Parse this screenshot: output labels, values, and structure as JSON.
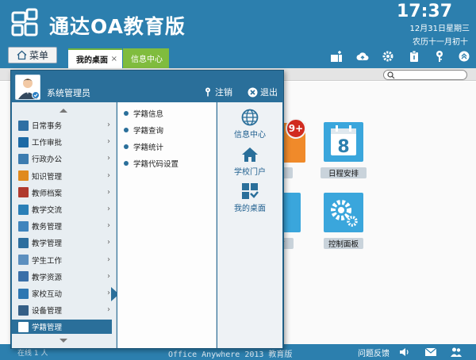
{
  "header": {
    "app_title": "通达OA教育版",
    "time": "17:37",
    "date": "12月31日星期三",
    "lunar_date": "农历十一月初十",
    "menu_label": "菜单"
  },
  "tabs": [
    {
      "label": "我的桌面",
      "close": "×"
    },
    {
      "label": "信息中心"
    }
  ],
  "desktop": {
    "badge": "9+",
    "tiles": [
      {
        "label": "乍"
      },
      {
        "label": "日程安排",
        "icon_number": "8"
      },
      {
        "label": "言"
      },
      {
        "label": "控制面板"
      }
    ]
  },
  "start_menu": {
    "user_name": "系统管理员",
    "logout_label": "注销",
    "exit_label": "退出",
    "items": [
      {
        "label": "日常事务",
        "color": "#2f6fa3"
      },
      {
        "label": "工作审批",
        "color": "#1d6aa5"
      },
      {
        "label": "行政办公",
        "color": "#3c7cb0"
      },
      {
        "label": "知识管理",
        "color": "#e08a1e"
      },
      {
        "label": "教师档案",
        "color": "#b03a2e"
      },
      {
        "label": "教学交流",
        "color": "#2a7fb7"
      },
      {
        "label": "教务管理",
        "color": "#3f84bd"
      },
      {
        "label": "教学管理",
        "color": "#2d6e9e"
      },
      {
        "label": "学生工作",
        "color": "#5c8fbf"
      },
      {
        "label": "教学资源",
        "color": "#3a6fa8"
      },
      {
        "label": "家校互动",
        "color": "#2e77b2"
      },
      {
        "label": "设备管理",
        "color": "#355f86"
      },
      {
        "label": "学籍管理",
        "color": "#ffffff"
      }
    ],
    "sub_items": [
      {
        "label": "学籍信息"
      },
      {
        "label": "学籍查询"
      },
      {
        "label": "学籍统计"
      },
      {
        "label": "学籍代码设置"
      }
    ],
    "quick_links": [
      {
        "label": "信息中心"
      },
      {
        "label": "学校门户"
      },
      {
        "label": "我的桌面"
      }
    ]
  },
  "footer": {
    "online_text": "在线 1 人",
    "product_text": "Office Anywhere 2013 教育版",
    "feedback_label": "问题反馈"
  },
  "colors": {
    "header_blue": "#2c7fae",
    "menu_blue": "#2a6f9a",
    "tab_green": "#80bc3e",
    "tile_blue": "#3aa6dc",
    "tile_orange": "#f08a2a",
    "badge_red": "#d12b1f"
  }
}
